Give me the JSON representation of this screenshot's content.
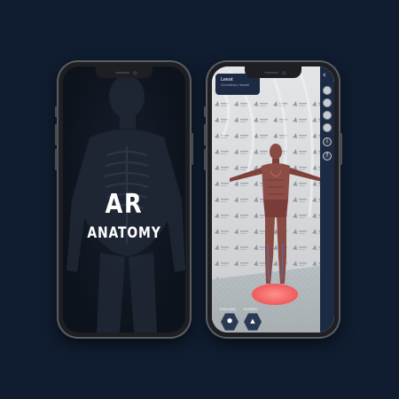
{
  "background_color": "#101d30",
  "splash": {
    "title": "AR",
    "subtitle": "ANATOMY"
  },
  "ar_view": {
    "info": {
      "title": "Leeat",
      "subtitle": "Circulatory model"
    },
    "panel_icons": [
      "chevron-left-icon",
      "muscle-layer-icon",
      "skeleton-layer-icon",
      "organs-layer-icon",
      "nerves-layer-icon",
      "info-icon",
      "help-icon"
    ],
    "tools": [
      {
        "label": "EXPLODE",
        "icon": "explode-icon"
      },
      {
        "label": "ROTATE",
        "icon": "rotate-icon"
      }
    ],
    "accent_color": "#ff6b6b",
    "panel_color": "#1c2a43"
  }
}
